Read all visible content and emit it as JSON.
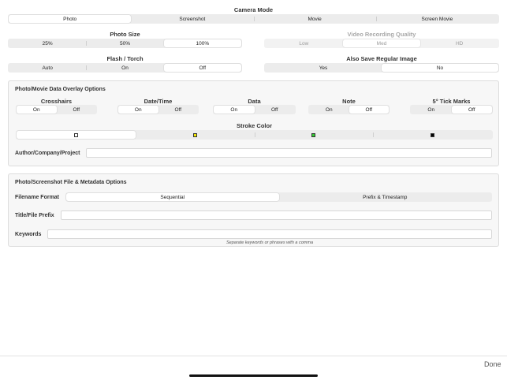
{
  "camera_mode": {
    "label": "Camera Mode",
    "options": [
      "Photo",
      "Screenshot",
      "Movie",
      "Screen Movie"
    ],
    "selected": "Photo"
  },
  "photo_size": {
    "label": "Photo Size",
    "options": [
      "25%",
      "50%",
      "100%"
    ],
    "selected": "100%"
  },
  "video_quality": {
    "label": "Video Recording Quality",
    "options": [
      "Low",
      "Med",
      "HD"
    ],
    "selected": "Med"
  },
  "flash": {
    "label": "Flash / Torch",
    "options": [
      "Auto",
      "On",
      "Off"
    ],
    "selected": "Off"
  },
  "save_regular": {
    "label": "Also Save Regular Image",
    "options": [
      "Yes",
      "No"
    ],
    "selected": "No"
  },
  "overlay": {
    "title": "Photo/Movie Data Overlay Options",
    "crosshairs": {
      "label": "Crosshairs",
      "on": "On",
      "off": "Off",
      "selected": "On"
    },
    "datetime": {
      "label": "Date/Time",
      "on": "On",
      "off": "Off",
      "selected": "On"
    },
    "data": {
      "label": "Data",
      "on": "On",
      "off": "Off",
      "selected": "On"
    },
    "note": {
      "label": "Note",
      "on": "On",
      "off": "Off",
      "selected": "Off"
    },
    "tick_marks": {
      "label": "5° Tick Marks",
      "on": "On",
      "off": "Off",
      "selected": "Off"
    },
    "stroke_color": {
      "label": "Stroke Color",
      "colors": [
        "#ffffff",
        "#f2e600",
        "#33cc33",
        "#000000"
      ],
      "selected_index": 0
    },
    "author": {
      "label": "Author/Company/Project",
      "value": ""
    }
  },
  "metadata": {
    "title": "Photo/Screenshot File & Metadata Options",
    "filename_format": {
      "label": "Filename Format",
      "options": [
        "Sequential",
        "Prefix & Timestamp"
      ],
      "selected": "Sequential"
    },
    "prefix": {
      "label": "Title/File Prefix",
      "value": ""
    },
    "keywords": {
      "label": "Keywords",
      "value": "",
      "hint": "Separate keywords or phrases with a comma"
    }
  },
  "footer": {
    "done_label": "Done"
  }
}
